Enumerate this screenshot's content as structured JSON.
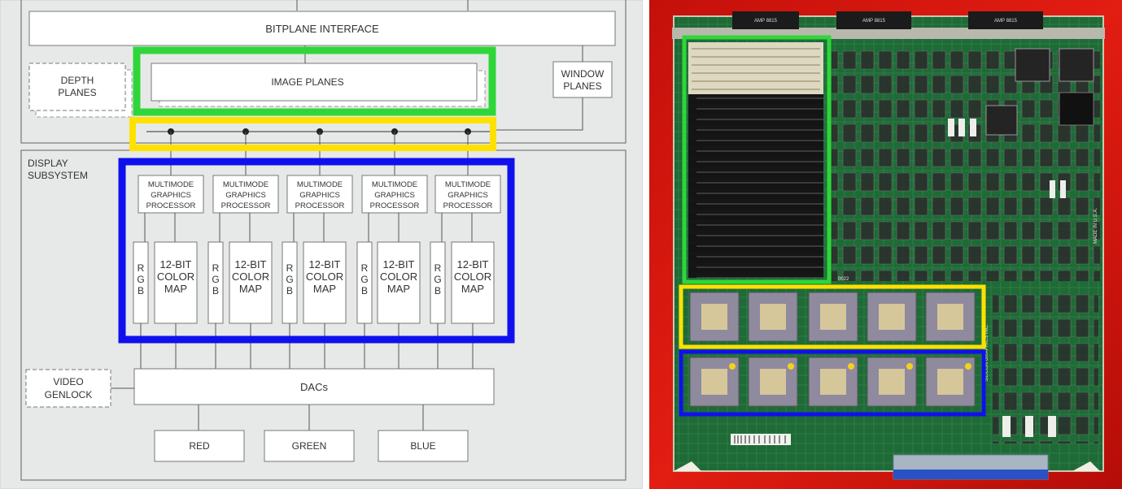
{
  "diagram": {
    "bitplane_interface": "BITPLANE INTERFACE",
    "depth_planes": [
      "DEPTH",
      "PLANES"
    ],
    "image_planes": "IMAGE PLANES",
    "window_planes": [
      "WINDOW",
      "PLANES"
    ],
    "display_subsystem": [
      "DISPLAY",
      "SUBSYSTEM"
    ],
    "processors": [
      {
        "label": [
          "MULTIMODE",
          "GRAPHICS",
          "PROCESSOR"
        ],
        "rgb": [
          "R",
          "G",
          "B"
        ],
        "colormap": [
          "12-BIT",
          "COLOR",
          "MAP"
        ]
      },
      {
        "label": [
          "MULTIMODE",
          "GRAPHICS",
          "PROCESSOR"
        ],
        "rgb": [
          "R",
          "G",
          "B"
        ],
        "colormap": [
          "12-BIT",
          "COLOR",
          "MAP"
        ]
      },
      {
        "label": [
          "MULTIMODE",
          "GRAPHICS",
          "PROCESSOR"
        ],
        "rgb": [
          "R",
          "G",
          "B"
        ],
        "colormap": [
          "12-BIT",
          "COLOR",
          "MAP"
        ]
      },
      {
        "label": [
          "MULTIMODE",
          "GRAPHICS",
          "PROCESSOR"
        ],
        "rgb": [
          "R",
          "G",
          "B"
        ],
        "colormap": [
          "12-BIT",
          "COLOR",
          "MAP"
        ]
      },
      {
        "label": [
          "MULTIMODE",
          "GRAPHICS",
          "PROCESSOR"
        ],
        "rgb": [
          "R",
          "G",
          "B"
        ],
        "colormap": [
          "12-BIT",
          "COLOR",
          "MAP"
        ]
      }
    ],
    "video_genlock": [
      "VIDEO",
      "GENLOCK"
    ],
    "dacs": "DACs",
    "outputs": [
      "RED",
      "GREEN",
      "BLUE"
    ]
  },
  "highlights": {
    "green": "#2fd63a",
    "yellow": "#ffe100",
    "blue": "#1010ee"
  },
  "board": {
    "labels": [
      "MADE IN U.S.A.",
      "SILICON GRAPHICS INC.",
      "0022"
    ],
    "connectors": [
      "AMP 8815",
      "AMP 8815",
      "AMP 8815"
    ]
  }
}
